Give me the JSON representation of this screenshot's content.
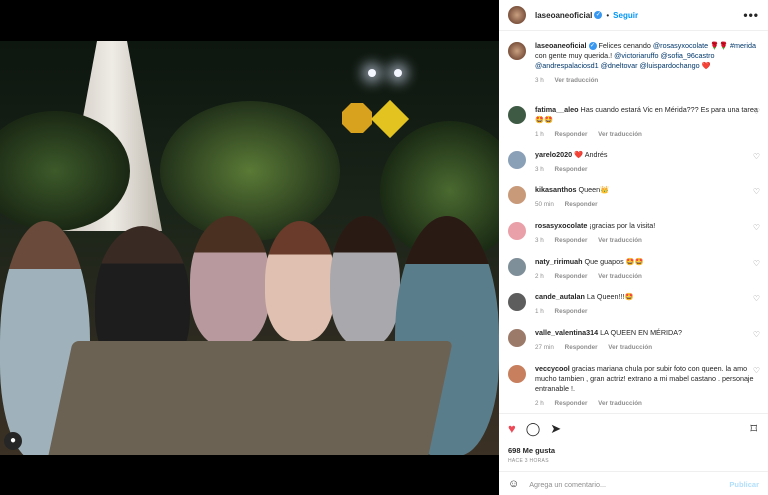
{
  "post": {
    "username": "laseoaneoficial",
    "follow_label": "Seguir",
    "separator": "•",
    "more_label": "•••",
    "caption_parts": {
      "text1": "Felices cenando ",
      "tag1": "@rosasyxocolate",
      "emoji1": " 🌹🌹",
      "text2": " ",
      "tag2": "#merida",
      "text3": " con gente muy querida.! ",
      "tag3": "@victoriaruffo",
      "text4": " ",
      "tag4": "@sofia_96castro",
      "text5": " ",
      "tag5": "@andrespalaciosd1",
      "text6": " ",
      "tag6": "@dneltovar",
      "text7": " ",
      "tag7": "@luispardochango",
      "emoji2": " ❤️"
    },
    "caption_time": "3 h",
    "caption_translate": "Ver traducción"
  },
  "comments": [
    {
      "user": "fatima__aleo",
      "text": " Has cuando estará Vic en Mérida??? Es para una tarea 🤩🤩",
      "time": "1 h",
      "reply": "Responder",
      "translate": "Ver traducción",
      "avatar_color": "#3e5a44"
    },
    {
      "user": "yarelo2020",
      "text": " ❤️ Andrés",
      "time": "3 h",
      "reply": "Responder",
      "translate": "",
      "avatar_color": "#8aa0b6"
    },
    {
      "user": "kikasanthos",
      "text": " Queen👑",
      "time": "50 min",
      "reply": "Responder",
      "translate": "",
      "avatar_color": "#c99a7a"
    },
    {
      "user": "rosasyxocolate",
      "text": " ¡gracias por la visita!",
      "time": "3 h",
      "reply": "Responder",
      "translate": "Ver traducción",
      "avatar_color": "#e9a0a8"
    },
    {
      "user": "naty_ririmuah",
      "text": " Que guapos 🤩🤩",
      "time": "2 h",
      "reply": "Responder",
      "translate": "Ver traducción",
      "avatar_color": "#7f8f99"
    },
    {
      "user": "cande_autalan",
      "text": " La Queen!!!🤩",
      "time": "1 h",
      "reply": "Responder",
      "translate": "",
      "avatar_color": "#5d5d5d"
    },
    {
      "user": "valle_valentina314",
      "text": " LA QUEEN EN MÉRIDA?",
      "time": "27 min",
      "reply": "Responder",
      "translate": "Ver traducción",
      "avatar_color": "#9b7a6a"
    },
    {
      "user": "veccycool",
      "text": " gracias mariana chula por subir foto con queen. la amo mucho tambien , gran actriz! extrano a mi mabel castano . personaje entranable !.",
      "time": "2 h",
      "reply": "Responder",
      "translate": "Ver traducción",
      "avatar_color": "#c77f5e"
    }
  ],
  "actions": {
    "like_icon": "heart-filled-icon",
    "comment_icon": "comment-icon",
    "share_icon": "send-icon",
    "save_icon": "bookmark-icon",
    "likes_text": "698 Me gusta",
    "ago_text": "HACE 3 HORAS"
  },
  "add_comment": {
    "placeholder": "Agrega un comentario...",
    "publish_label": "Publicar",
    "emoji_icon": "smiley-icon"
  },
  "colors": {
    "accent": "#0095f6",
    "like": "#ed4956",
    "muted": "#8e8e8e"
  }
}
